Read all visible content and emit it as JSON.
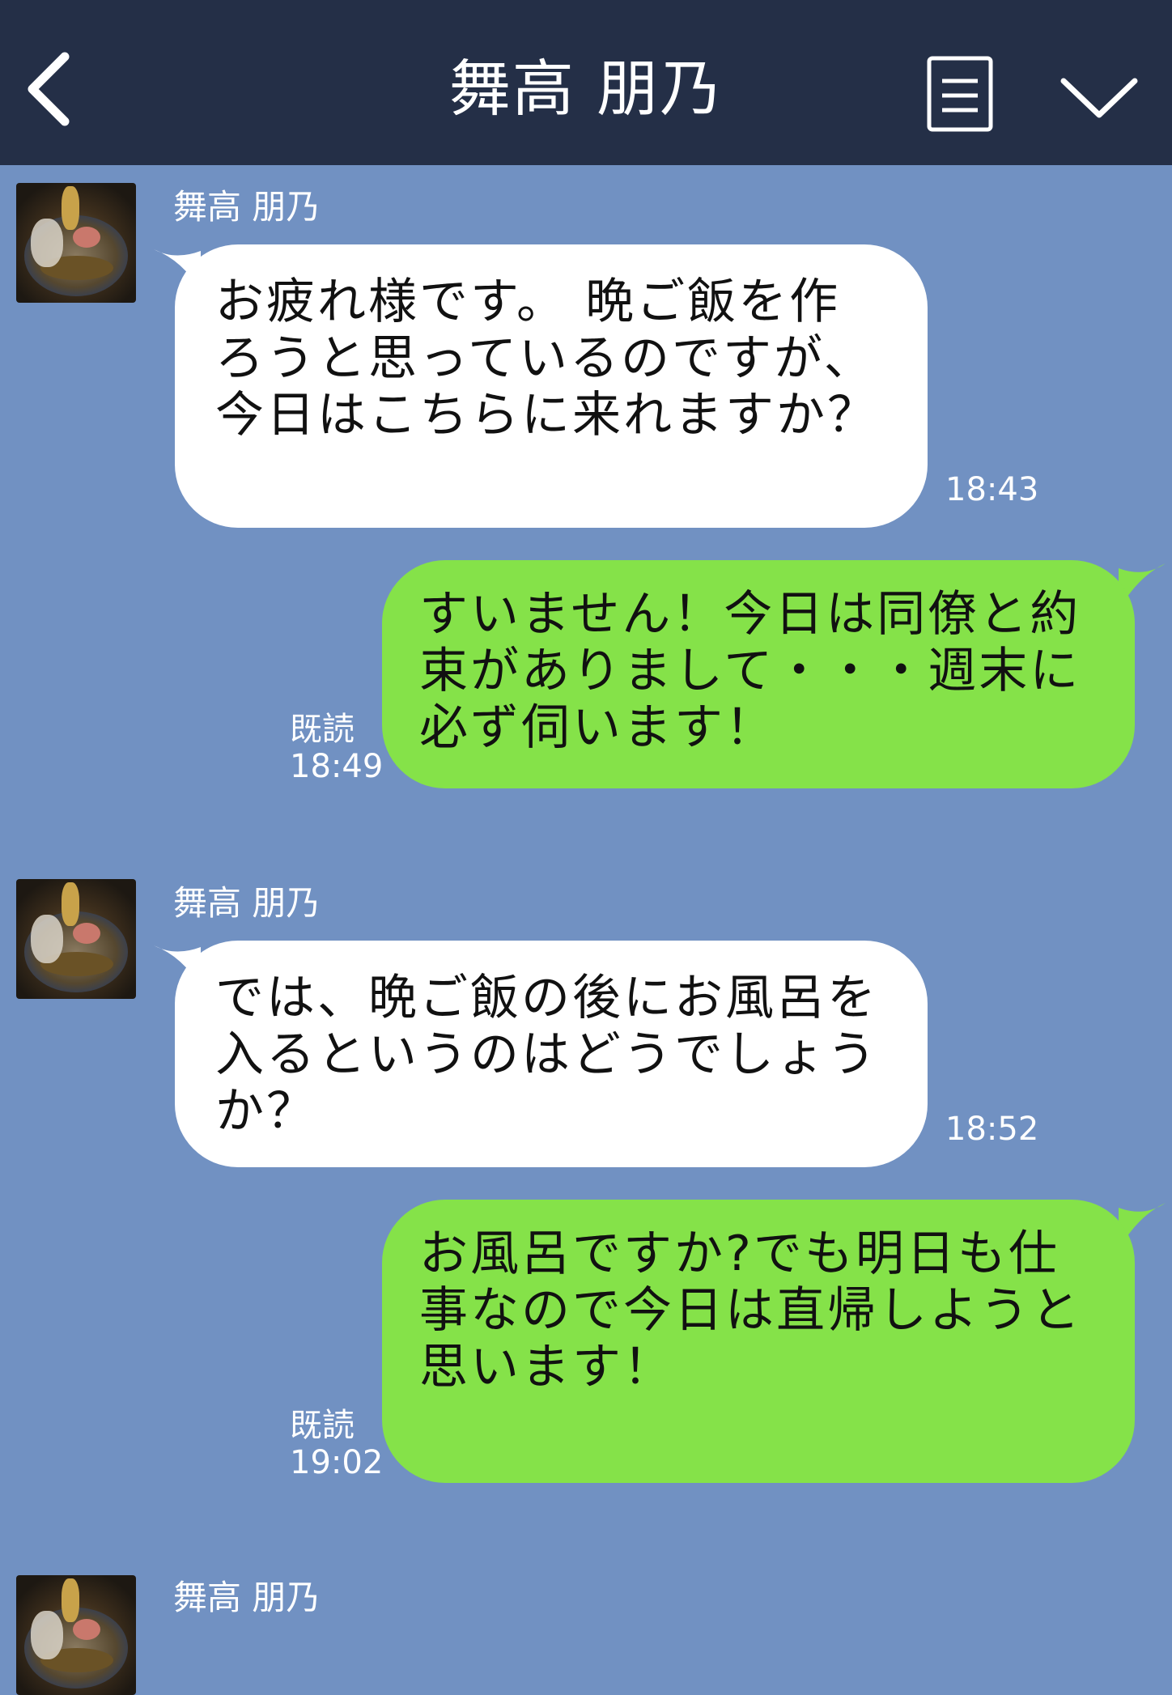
{
  "header": {
    "title": "舞高 朋乃",
    "back_icon": "chevron-left-icon",
    "menu_icon": "menu-list-icon",
    "collapse_icon": "chevron-down-icon"
  },
  "colors": {
    "header_bg": "#242f47",
    "chat_bg": "#7191c2",
    "outgoing_bubble": "#85e249",
    "incoming_bubble": "#ffffff"
  },
  "messages": [
    {
      "sender": "舞高 朋乃",
      "direction": "incoming",
      "text": "お疲れ様です。 晩ご飯を作ろうと思っているのですが、今日はこちらに来れますか？",
      "time": "18:43"
    },
    {
      "direction": "outgoing",
      "text": "すいません！今日は同僚と約束がありまして・・・週末に必ず伺います！",
      "read_label": "既読",
      "time": "18:49"
    },
    {
      "sender": "舞高 朋乃",
      "direction": "incoming",
      "text": "では、晩ご飯の後にお風呂を入るというのはどうでしょうか？",
      "time": "18:52"
    },
    {
      "direction": "outgoing",
      "text": "お風呂ですか?でも明日も仕事なので今日は直帰しようと思います！",
      "read_label": "既読",
      "time": "19:02"
    },
    {
      "sender": "舞高 朋乃",
      "direction": "incoming",
      "text": "",
      "time": ""
    }
  ]
}
